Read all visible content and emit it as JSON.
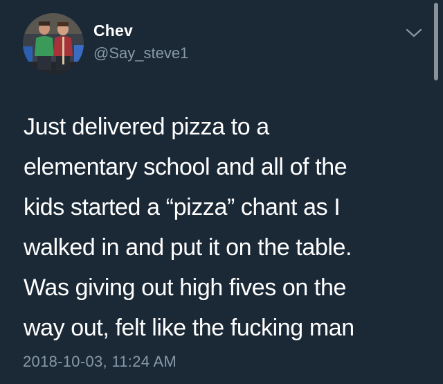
{
  "author": {
    "display_name": "Chev",
    "handle": "@Say_steve1",
    "avatar_icon": "profile-photo-two-people"
  },
  "tweet": {
    "lines": [
      "Just delivered pizza to a",
      "elementary school and all of the",
      "kids started a “pizza” chant as I",
      "walked in and put it on the table.",
      "Was giving out high fives on the",
      "way out, felt like the fucking man"
    ],
    "timestamp": "2018-10-03, 11:24 AM"
  },
  "icons": {
    "menu": "chevron-down-icon"
  },
  "colors": {
    "background": "#1b2836",
    "text": "#ffffff",
    "secondary_text": "#8899a6"
  }
}
